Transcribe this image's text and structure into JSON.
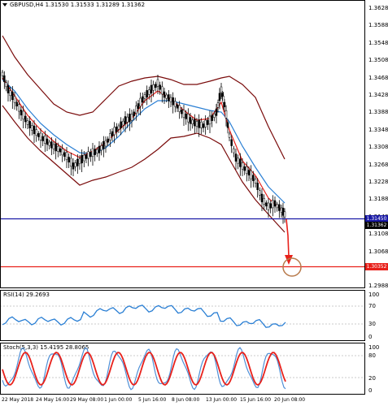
{
  "chart": {
    "title": "GBPUSD,H4  1.31530 1.31533 1.31289 1.31362",
    "price_axis": [
      "1.36280",
      "1.35880",
      "1.35480",
      "1.35080",
      "1.34680",
      "1.34280",
      "1.33880",
      "1.33480",
      "1.33080",
      "1.32680",
      "1.32280",
      "1.31880",
      "1.31480",
      "1.31080",
      "1.30680",
      "1.30280",
      "1.29880"
    ],
    "blue_line_label": "1.31450",
    "current_price_label": "1.31362",
    "red_line_label": "1.30352",
    "time_axis": [
      "22 May 2018",
      "24 May 16:00",
      "29 May 08:00",
      "1 Jun 00:00",
      "5 Jun 16:00",
      "8 Jun 08:00",
      "13 Jun 00:00",
      "15 Jun 16:00",
      "20 Jun 08:00"
    ],
    "colors": {
      "blue_level": "#1a1aa6",
      "red_level": "#e8211b",
      "bands": "#7a0b0b",
      "ma_fast": "#e8211b",
      "ma_slow": "#2a7fd4",
      "candles": "#000000"
    }
  },
  "rsi": {
    "title": "RSI(14) 29.2693",
    "axis": [
      "100",
      "70",
      "30",
      "0"
    ]
  },
  "stoch": {
    "title": "Stoch(5,3,3) 15.4195 28.8065",
    "axis": [
      "100",
      "80",
      "20",
      "0"
    ]
  }
}
